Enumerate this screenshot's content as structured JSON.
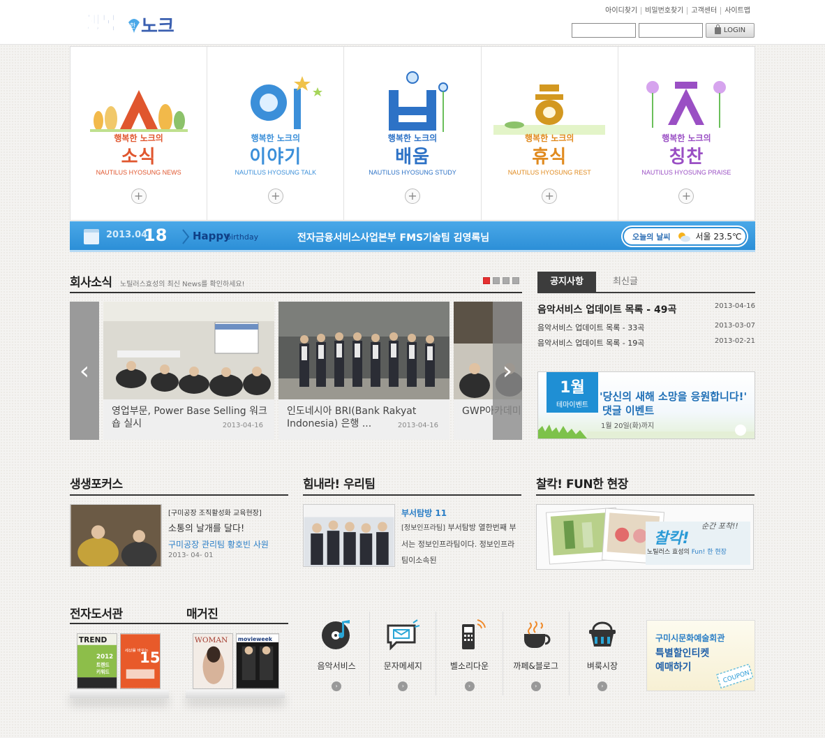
{
  "header": {
    "logo_text": "행복한노크",
    "util_links": [
      "아이디찾기",
      "비밀번호찾기",
      "고객센터",
      "사이트맵"
    ],
    "login_label": "LOGIN"
  },
  "categories": [
    {
      "sub": "행복한 노크의",
      "title": "소식",
      "eng": "NAUTILUS HYOSUNG NEWS",
      "color": "#e0562e"
    },
    {
      "sub": "행복한 노크의",
      "title": "이야기",
      "eng": "NAUTILUS HYOSUNG TALK",
      "color": "#3b8fd9"
    },
    {
      "sub": "행복한 노크의",
      "title": "배움",
      "eng": "NAUTILUS HYOSUNG STUDY",
      "color": "#2d72c6"
    },
    {
      "sub": "행복한 노크의",
      "title": "휴식",
      "eng": "NAUTILUS HYOSUNG REST",
      "color": "#e08a1e"
    },
    {
      "sub": "행복한 노크의",
      "title": "칭찬",
      "eng": "NAUTILUS HYOSUNG PRAISE",
      "color": "#9a4fc4"
    }
  ],
  "banner": {
    "date_prefix": "2013.04.",
    "date_day": "18",
    "happy": "Happy",
    "birthday": "birthday",
    "message": "전자금융서비스사업본부 FMS기술팀 김영록님",
    "weather_label": "오늘의 날씨",
    "weather_value": "서울 23.5℃"
  },
  "company_news": {
    "title": "회사소식",
    "desc": "노틸러스효성의 최신 News를 확인하세요!",
    "slides": [
      {
        "caption": "영업부문, Power Base Selling 워크숍 실시",
        "date": "2013-04-16"
      },
      {
        "caption": "인도네시아 BRI(Bank Rakyat Indonesia) 은행 ...",
        "date": "2013-04-16"
      },
      {
        "caption": "GWP아카데미 빛나는 리더",
        "date": ""
      }
    ]
  },
  "notice": {
    "tabs": [
      "공지사항",
      "최신글"
    ],
    "items": [
      {
        "title": "음악서비스 업데이트 목록 - 49곡",
        "date": "2013-04-16"
      },
      {
        "title": "음악서비스 업데이트 목록 - 33곡",
        "date": "2013-03-07"
      },
      {
        "title": "음악서비스 업데이트 목록 - 19곡",
        "date": "2013-02-21"
      }
    ],
    "event": {
      "month": "1월",
      "label": "테마이벤트",
      "line1": "'당신의 새해 소망을 응원합니다!'",
      "line2": "댓글 이벤트",
      "until": "1월 20일(화)까지"
    }
  },
  "focus": {
    "title": "생생포커스",
    "tag": "[구미공장 조직활성화 교육현장]",
    "head": "소통의 날개를 달다!",
    "sub": "구미공장 관리팀 황호빈 사원",
    "date": "2013- 04- 01"
  },
  "team": {
    "title": "힘내라! 우리팀",
    "item_title": "부서탐방 11",
    "text_tag": "[정보인프라팀]",
    "text": "부서탐방 열한번째 부서는 정보인프라팀이다. 정보인프라팀이소속된"
  },
  "fun": {
    "title": "찰칵! FUN한 현장",
    "script": "찰칵!",
    "script2": "순간 포착!!",
    "caption_pre": "노틸러스 효성의",
    "caption_em": "Fun! 한 현장"
  },
  "ebook": {
    "title": "전자도서관",
    "book1_top": "TREND",
    "book1_mid": "2012 트렌드 키워드",
    "book2": "15"
  },
  "magazine": {
    "title": "매거진",
    "mag1": "WOMAN",
    "mag2": "movieweek"
  },
  "services": [
    {
      "label": "음악서비스",
      "icon": "music-disc-icon"
    },
    {
      "label": "문자메세지",
      "icon": "envelope-message-icon"
    },
    {
      "label": "벨소리다운",
      "icon": "phone-ringtone-icon"
    },
    {
      "label": "까페&블로그",
      "icon": "coffee-cup-icon"
    },
    {
      "label": "벼룩시장",
      "icon": "basket-icon"
    }
  ],
  "coupon": {
    "line1": "구미시문화예술회관",
    "line2": "특별할인티켓",
    "line3": "예매하기",
    "stamp": "COUPON"
  }
}
